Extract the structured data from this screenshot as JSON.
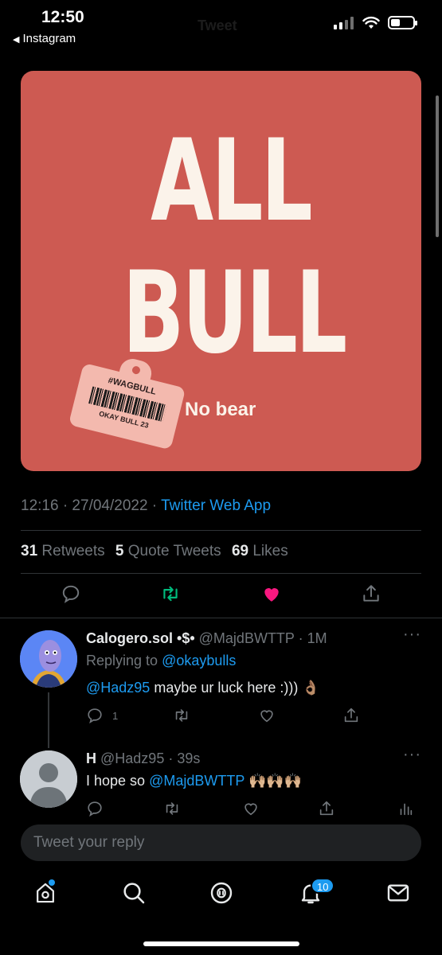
{
  "status_bar": {
    "time": "12:50",
    "back_app": "Instagram",
    "ghost_title": "Tweet"
  },
  "media": {
    "headline_1": "ALL",
    "headline_2": "BULL",
    "subline": "No bear",
    "tag_hashtag": "#WAGBULL",
    "tag_id": "OKAY BULL 23"
  },
  "tweet": {
    "timestamp": "12:16 · 27/04/2022 · ",
    "source": "Twitter Web App",
    "retweets_count": "31",
    "retweets_label": "Retweets",
    "quotes_count": "5",
    "quotes_label": "Quote Tweets",
    "likes_count": "69",
    "likes_label": "Likes",
    "liked": true
  },
  "replies": [
    {
      "name": "Calogero.sol •$•",
      "handle": "@MajdBWTTP · 1M",
      "replying_prefix": "Replying to ",
      "replying_to": "@okaybulls",
      "mention": "@Hadz95",
      "text": " maybe ur luck here :))) 👌🏽",
      "reply_count": "1"
    },
    {
      "name": "H",
      "handle": "@Hadz95 · 39s",
      "text_prefix": "I hope so ",
      "mention": "@MajdBWTTP",
      "text_suffix": " 🙌🏼🙌🏼🙌🏼"
    }
  ],
  "composer": {
    "placeholder": "Tweet your reply"
  },
  "tabbar": {
    "notifications_badge": "10"
  },
  "colors": {
    "accent": "#1d9bf0",
    "like": "#f91880",
    "retweet": "#00ba7c",
    "card": "#cd5a52"
  }
}
